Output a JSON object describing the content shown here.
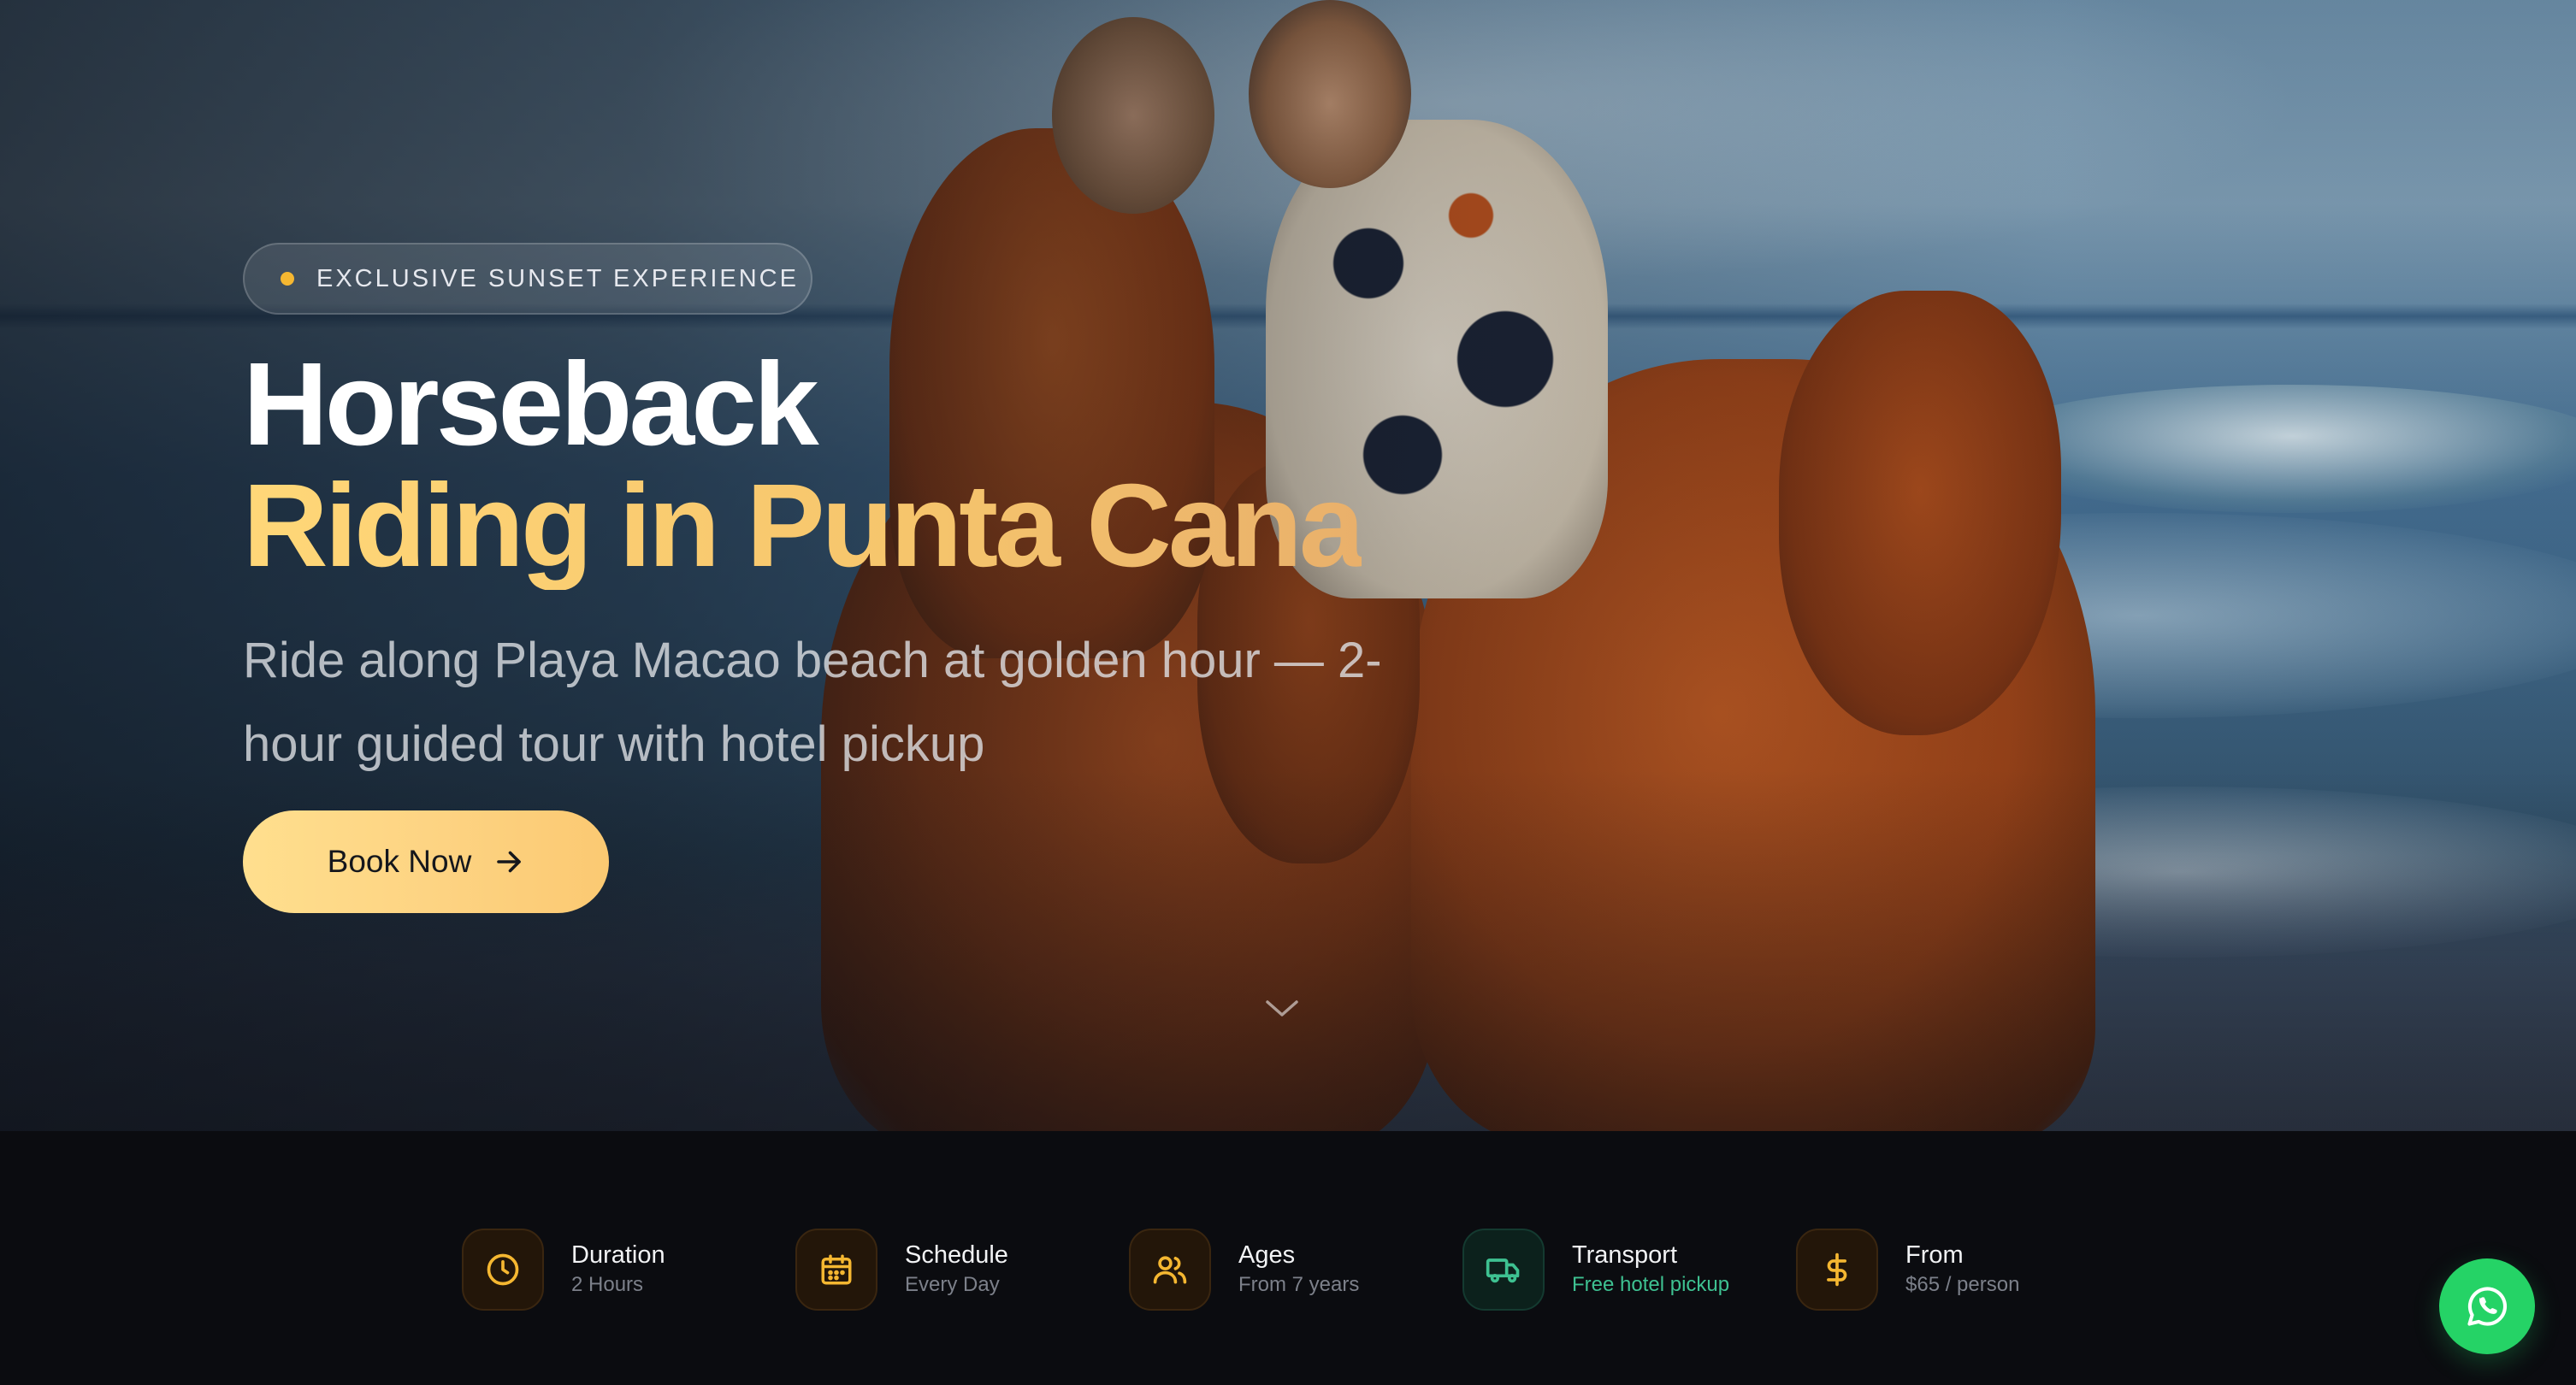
{
  "hero": {
    "badge_text": "EXCLUSIVE SUNSET EXPERIENCE",
    "title_line1": "Horseback",
    "title_line2": "Riding in Punta Cana",
    "subtitle": "Ride along Playa Macao beach at golden hour — 2-hour guided tour with hotel pickup",
    "cta_label": "Book Now"
  },
  "features": [
    {
      "title": "Duration",
      "subtitle": "2 Hours",
      "icon": "clock-icon"
    },
    {
      "title": "Schedule",
      "subtitle": "Every Day",
      "icon": "calendar-icon"
    },
    {
      "title": "Ages",
      "subtitle": "From 7 years",
      "icon": "users-icon"
    },
    {
      "title": "Transport",
      "subtitle": "Free hotel pickup",
      "icon": "truck-icon"
    },
    {
      "title": "From",
      "subtitle": "$65 / person",
      "icon": "dollar-icon"
    }
  ],
  "colors": {
    "accent": "#f5b731",
    "gold_gradient_start": "#ffdf8e",
    "gold_gradient_end": "#fbc972",
    "green_accent": "#3ec191",
    "whatsapp": "#25d366",
    "bar_background": "#0b0c10"
  }
}
